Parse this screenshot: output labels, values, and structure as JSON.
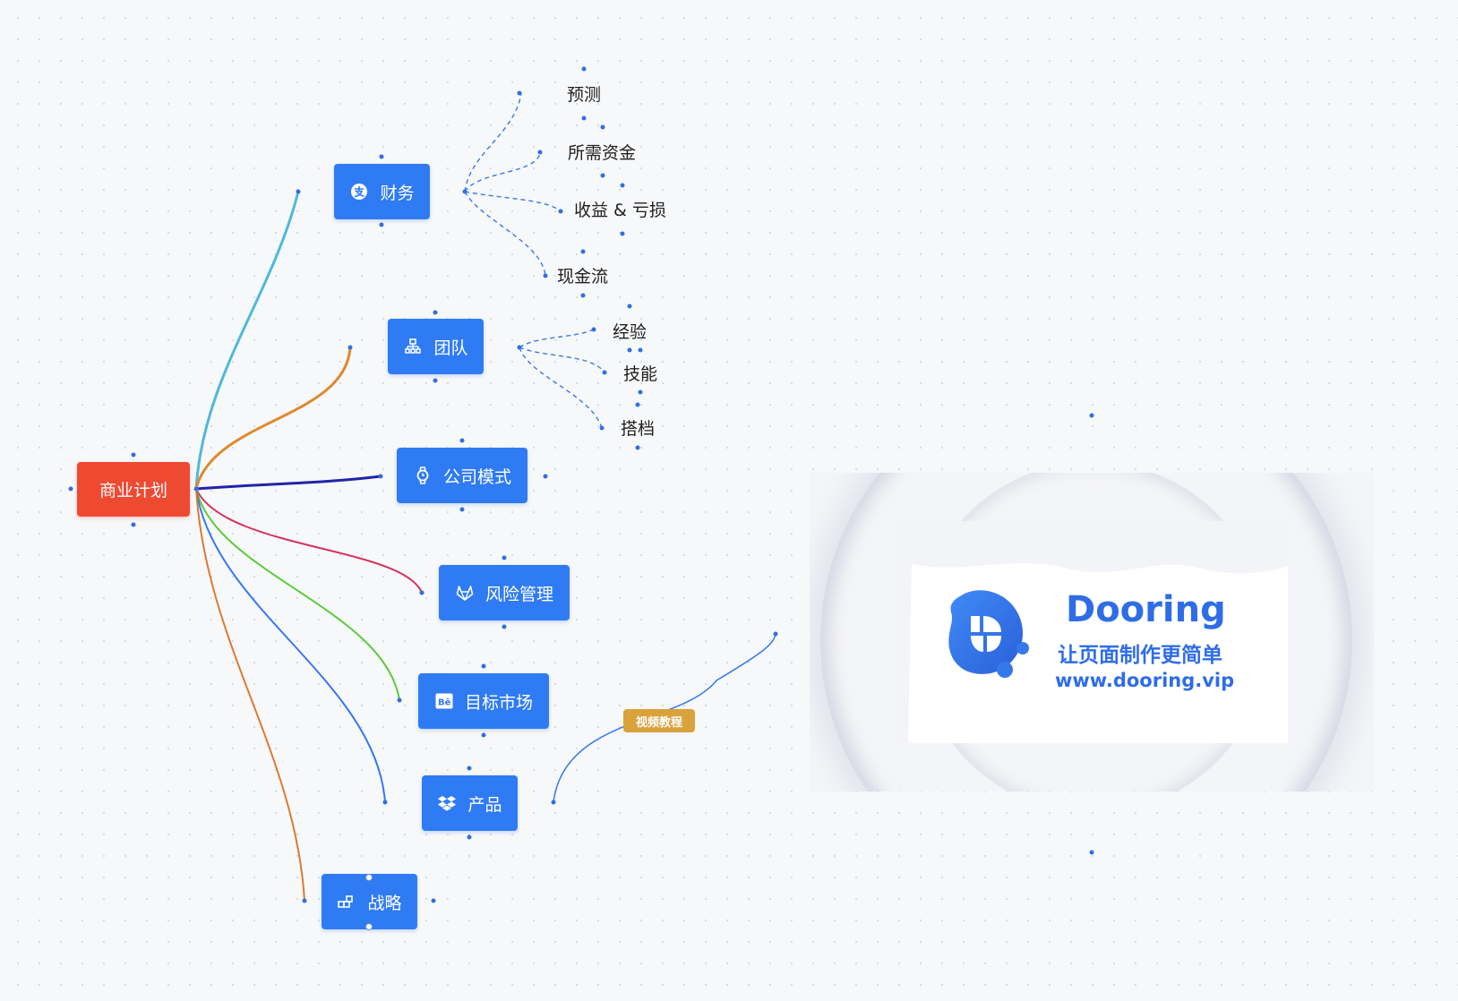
{
  "mindmap": {
    "root": {
      "label": "商业计划",
      "color": "#ee4a32"
    },
    "node_color": "#2f7bf3",
    "branches": [
      {
        "id": "finance",
        "label": "财务",
        "icon": "alipay-icon",
        "edge_color": "#4fb8dc",
        "children": [
          "预测",
          "所需资金",
          "收益 & 亏损",
          "现金流"
        ]
      },
      {
        "id": "team",
        "label": "团队",
        "icon": "org-chart-icon",
        "edge_color": "#dd8a2f",
        "children": [
          "经验",
          "技能",
          "搭档"
        ]
      },
      {
        "id": "model",
        "label": "公司模式",
        "icon": "watch-icon",
        "edge_color": "#2124a8",
        "children": []
      },
      {
        "id": "risk",
        "label": "风险管理",
        "icon": "gitlab-icon",
        "edge_color": "#d6325c",
        "children": []
      },
      {
        "id": "market",
        "label": "目标市场",
        "icon": "behance-icon",
        "edge_color": "#5ccb3a",
        "children": []
      },
      {
        "id": "product",
        "label": "产品",
        "icon": "dropbox-icon",
        "edge_color": "#3478ec",
        "children": []
      },
      {
        "id": "strategy",
        "label": "战略",
        "icon": "blocks-icon",
        "edge_color": "#dd7a2f",
        "children": []
      }
    ],
    "tag": {
      "label": "视频教程",
      "color": "#d9a23b"
    }
  },
  "ad": {
    "brand": "Dooring",
    "slogan": "让页面制作更简单",
    "url": "www.dooring.vip",
    "accent": "#2f6de6"
  }
}
